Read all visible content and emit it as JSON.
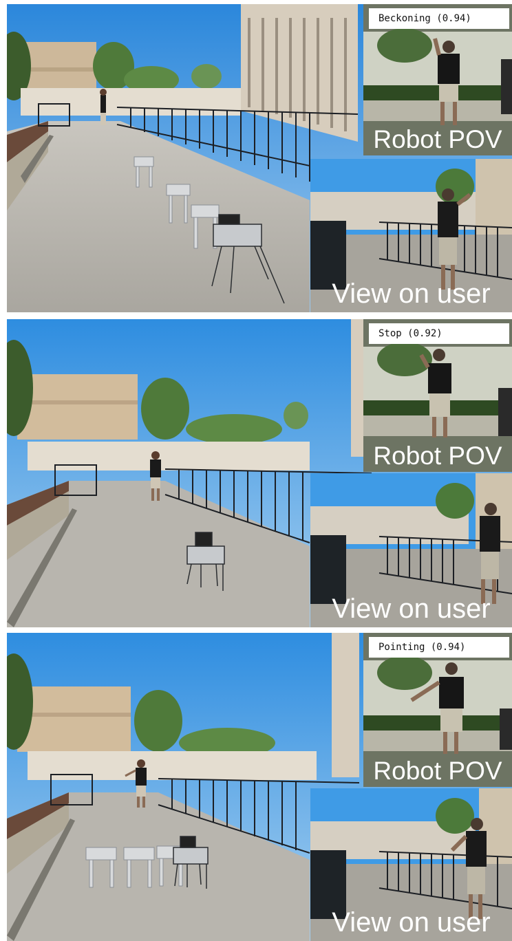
{
  "panels": [
    {
      "gesture_label": "Beckoning (0.94)",
      "pov_label": "Robot POV",
      "view_label": "View on user"
    },
    {
      "gesture_label": "Stop (0.92)",
      "pov_label": "Robot POV",
      "view_label": "View on user"
    },
    {
      "gesture_label": "Pointing (0.94)",
      "pov_label": "Robot POV",
      "view_label": "View on user"
    }
  ],
  "colors": {
    "sky": "#2f8fe0",
    "pavement": "#b4b1aa",
    "fence": "#1c1f24",
    "wall": "#d9c7a9",
    "overlay_label": "#ffffff"
  }
}
